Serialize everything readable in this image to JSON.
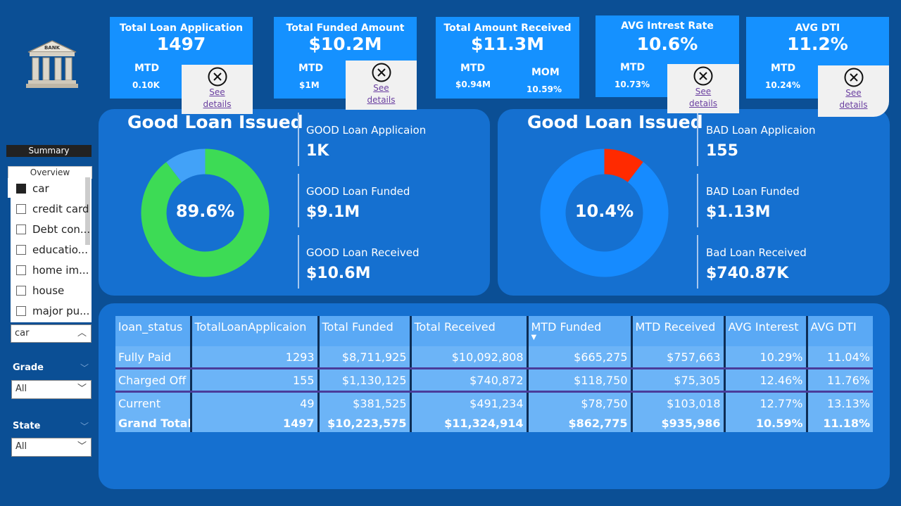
{
  "kpis": [
    {
      "title": "Total Loan Application",
      "value": "1497",
      "sub1_label": "MTD",
      "sub1_value": "0.10K"
    },
    {
      "title": "Total Funded Amount",
      "value": "$10.2M",
      "sub1_label": "MTD",
      "sub1_value": "$1M"
    },
    {
      "title": "Total Amount Received",
      "value": "$11.3M",
      "sub1_label": "MTD",
      "sub1_value": "$0.94M",
      "sub2_label": "MOM",
      "sub2_value": "10.59%"
    },
    {
      "title": "AVG Intrest Rate",
      "value": "10.6%",
      "sub1_label": "MTD",
      "sub1_value": "10.73%"
    },
    {
      "title": "AVG DTI",
      "value": "11.2%",
      "sub1_label": "MTD",
      "sub1_value": "10.24%"
    }
  ],
  "detail_popup": {
    "link_line1": "See",
    "link_line2": "details"
  },
  "logo": {
    "text": "BANK"
  },
  "sidebar": {
    "summary_tab": "Summary",
    "overview_tab": "Overview",
    "purpose_items": [
      {
        "label": "car",
        "checked": true
      },
      {
        "label": "credit card",
        "checked": false
      },
      {
        "label": "Debt con...",
        "checked": false
      },
      {
        "label": "educatio...",
        "checked": false
      },
      {
        "label": "home im...",
        "checked": false
      },
      {
        "label": "house",
        "checked": false
      },
      {
        "label": "major pu...",
        "checked": false
      }
    ],
    "purpose_selected": "car",
    "grade_label": "Grade",
    "grade_value": "All",
    "state_label": "State",
    "state_value": "All"
  },
  "good_panel": {
    "title": "Good Loan Issued",
    "percent_label": "89.6%",
    "percent": 89.6,
    "colors": {
      "main": "#3ddb55",
      "rest": "#42a2f8"
    },
    "stats": [
      {
        "label": "GOOD Loan Applicaion",
        "value": "1K"
      },
      {
        "label": "GOOD Loan Funded",
        "value": "$9.1M"
      },
      {
        "label": "GOOD Loan Received",
        "value": "$10.6M"
      }
    ]
  },
  "bad_panel": {
    "title": "Good Loan Issued",
    "percent_label": "10.4%",
    "percent": 10.4,
    "colors": {
      "main": "#ff2a00",
      "rest": "#168bff"
    },
    "stats": [
      {
        "label": "BAD Loan Applicaion",
        "value": "155"
      },
      {
        "label": "BAD Loan Funded",
        "value": "$1.13M"
      },
      {
        "label": "Bad Loan Received",
        "value": "$740.87K"
      }
    ]
  },
  "table": {
    "headers": [
      "loan_status",
      "TotalLoanApplicaion",
      "Total Funded",
      "Total Received",
      "MTD Funded",
      "MTD Received",
      "AVG Interest",
      "AVG DTI"
    ],
    "sorted_column": "MTD Funded",
    "rows": [
      [
        "Fully Paid",
        "1293",
        "$8,711,925",
        "$10,092,808",
        "$665,275",
        "$757,663",
        "10.29%",
        "11.04%"
      ],
      [
        "Charged Off",
        "155",
        "$1,130,125",
        "$740,872",
        "$118,750",
        "$75,305",
        "12.46%",
        "11.76%"
      ],
      [
        "Current",
        "49",
        "$381,525",
        "$491,234",
        "$78,750",
        "$103,018",
        "12.77%",
        "13.13%"
      ]
    ],
    "total": [
      "Grand Total",
      "1497",
      "$10,223,575",
      "$11,324,914",
      "$862,775",
      "$935,986",
      "10.59%",
      "11.18%"
    ]
  }
}
